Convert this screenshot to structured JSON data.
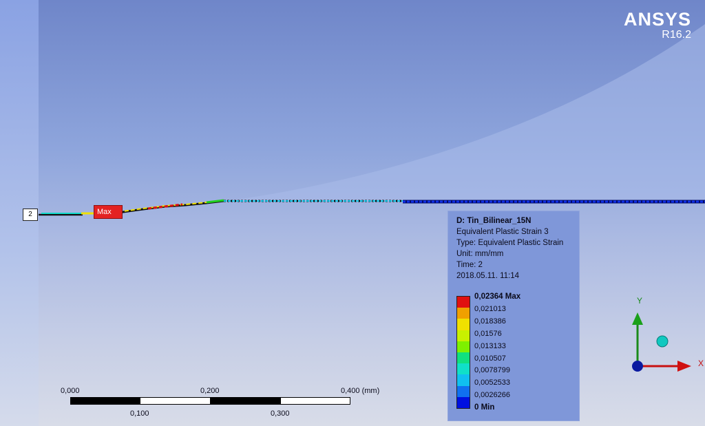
{
  "brand": {
    "name": "ANSYS",
    "version": "R16.2"
  },
  "model": {
    "node_tag": "2",
    "max_tag": "Max"
  },
  "legend": {
    "title": "D: Tin_Bilinear_15N",
    "result": "Equivalent Plastic Strain 3",
    "type": "Type: Equivalent Plastic Strain",
    "unit": "Unit: mm/mm",
    "time": "Time: 2",
    "timestamp": "2018.05.11. 11:14",
    "levels": [
      {
        "label": "0,02364 Max",
        "color": "#e01010"
      },
      {
        "label": "0,021013",
        "color": "#f0a000"
      },
      {
        "label": "0,018386",
        "color": "#f0e000"
      },
      {
        "label": "0,01576",
        "color": "#c8f000"
      },
      {
        "label": "0,013133",
        "color": "#7ef000"
      },
      {
        "label": "0,010507",
        "color": "#10e080"
      },
      {
        "label": "0,0078799",
        "color": "#10e0c8"
      },
      {
        "label": "0,0052533",
        "color": "#10c0f0"
      },
      {
        "label": "0,0026266",
        "color": "#1070f0"
      },
      {
        "label": "0 Min",
        "color": "#0010e0"
      }
    ]
  },
  "scale_bar": {
    "ticks_top": [
      "0,000",
      "0,200",
      "0,400 (mm)"
    ],
    "ticks_bottom": [
      "0,100",
      "0,300"
    ]
  },
  "triad": {
    "x_label": "X",
    "y_label": "Y"
  }
}
